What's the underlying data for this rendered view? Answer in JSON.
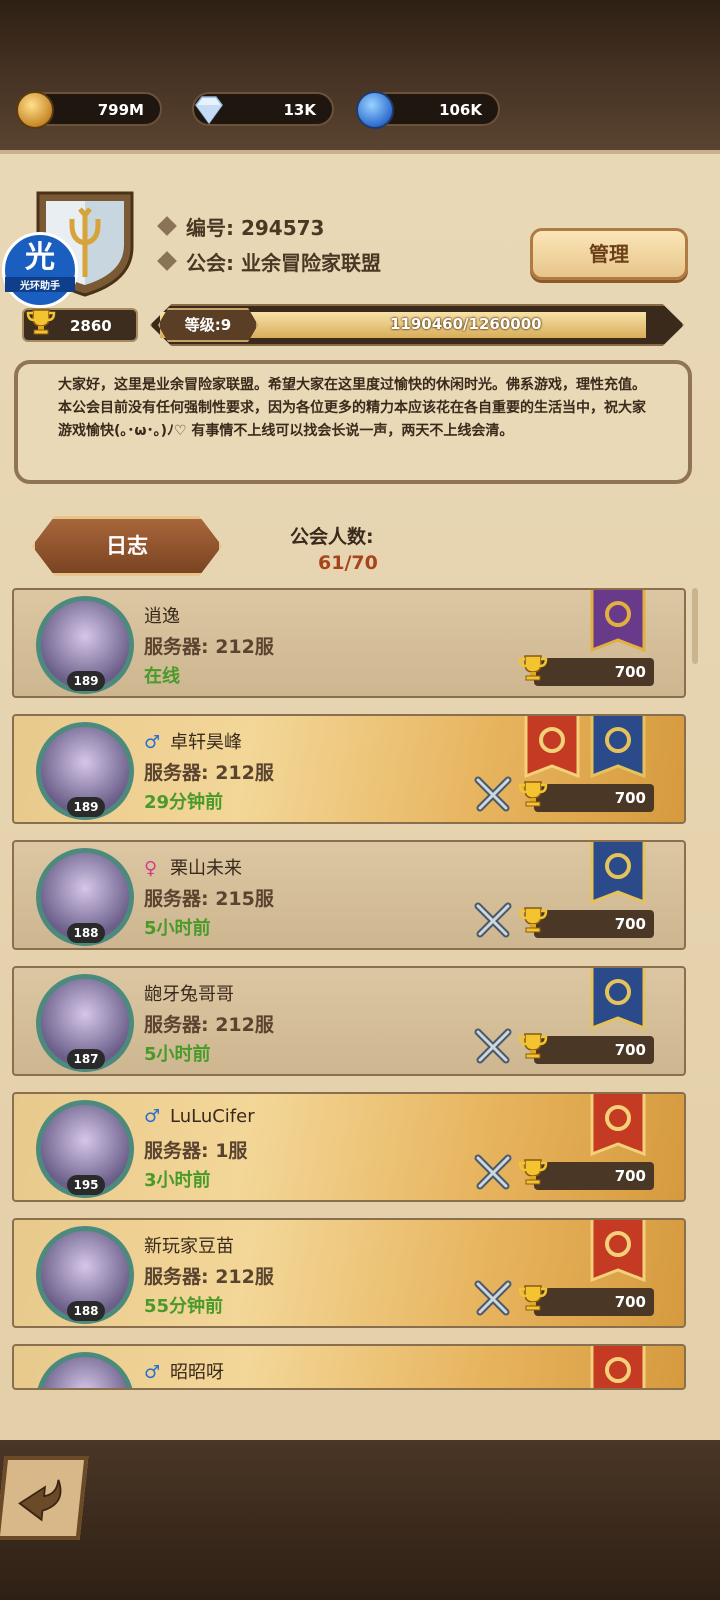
{
  "resources": [
    {
      "icon": "gold-coin-icon",
      "value": "799M"
    },
    {
      "icon": "diamond-icon",
      "value": "13K"
    },
    {
      "icon": "blue-orb-icon",
      "value": "106K"
    }
  ],
  "watermark": {
    "text": "光",
    "subtitle": "光环助手"
  },
  "guild": {
    "id_label": "编号: 294573",
    "name_label": "公会:",
    "name": "业余冒险家联盟",
    "manage_label": "管理",
    "trophies": "2860",
    "level_label": "等级:9",
    "xp_text": "1190460/1260000",
    "xp_fraction": 0.9448,
    "notice": "大家好，这里是业余冒险家联盟。希望大家在这里度过愉快的休闲时光。佛系游戏，理性充值。本公会目前没有任何强制性要求，因为各位更多的精力本应该花在各自重要的生活当中，祝大家游戏愉快(｡･ω･｡)ﾉ♡ 有事情不上线可以找会长说一声，两天不上线会清。",
    "log_label": "日志",
    "member_label": "公会人数:",
    "member_count": "61/70"
  },
  "members": [
    {
      "name": "逍逸",
      "gender": "",
      "server": "服务器: 212服",
      "status": "在线",
      "level": "189",
      "trophies": "700",
      "gold": false,
      "swords": false,
      "banners": [
        "purple"
      ]
    },
    {
      "name": "卓轩昊峰",
      "gender": "♂",
      "server": "服务器: 212服",
      "status": "29分钟前",
      "level": "189",
      "trophies": "700",
      "gold": true,
      "swords": true,
      "banners": [
        "red",
        "blue"
      ]
    },
    {
      "name": "栗山未来",
      "gender": "♀",
      "server": "服务器: 215服",
      "status": "5小时前",
      "level": "188",
      "trophies": "700",
      "gold": false,
      "swords": true,
      "banners": [
        "blue"
      ]
    },
    {
      "name": "龅牙兔哥哥",
      "gender": "",
      "server": "服务器: 212服",
      "status": "5小时前",
      "level": "187",
      "trophies": "700",
      "gold": false,
      "swords": true,
      "banners": [
        "blue"
      ]
    },
    {
      "name": "LuLuCifer",
      "gender": "♂",
      "server": "服务器: 1服",
      "status": "3小时前",
      "level": "195",
      "trophies": "700",
      "gold": true,
      "swords": true,
      "banners": [
        "red"
      ]
    },
    {
      "name": "新玩家豆苗",
      "gender": "",
      "server": "服务器: 212服",
      "status": "55分钟前",
      "level": "188",
      "trophies": "700",
      "gold": true,
      "swords": true,
      "banners": [
        "red"
      ]
    },
    {
      "name": "昭昭呀",
      "gender": "♂",
      "server": "",
      "status": "",
      "level": "",
      "trophies": "",
      "gold": true,
      "swords": false,
      "banners": [
        "red"
      ]
    }
  ]
}
